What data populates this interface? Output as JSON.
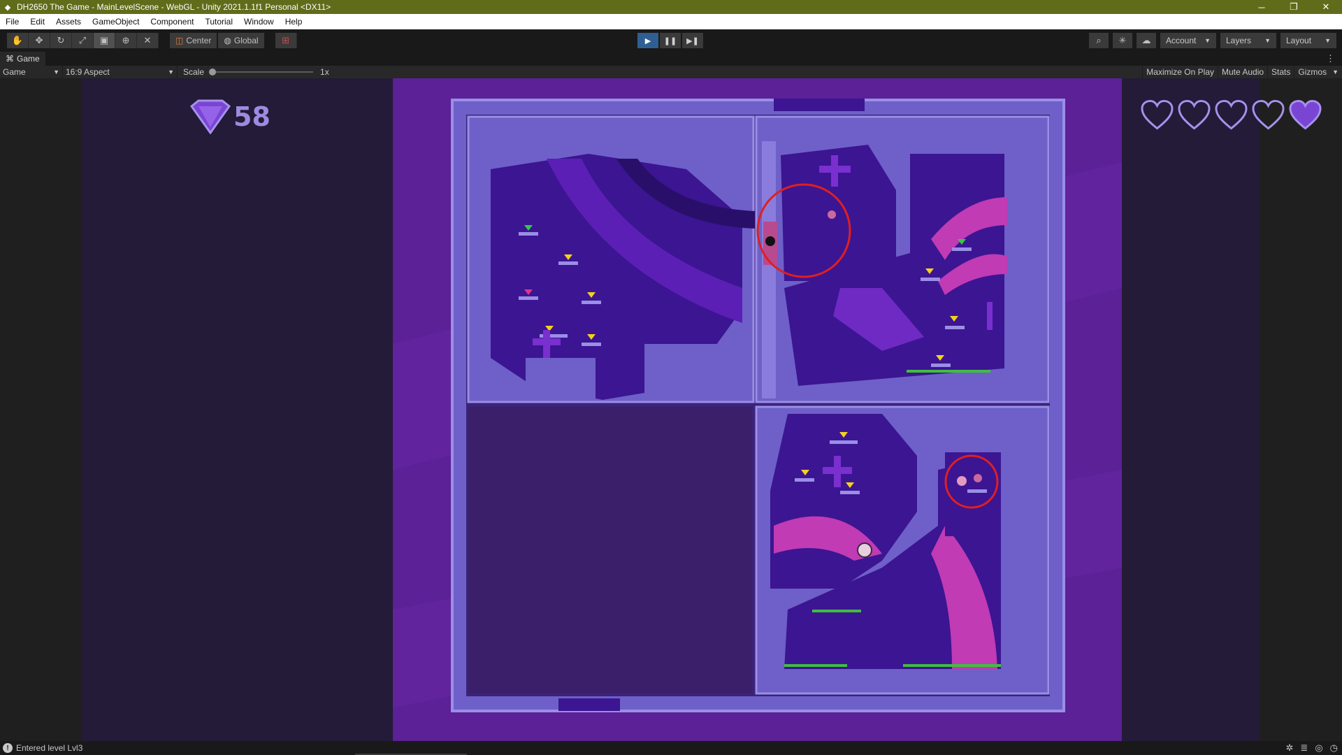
{
  "window": {
    "title": "DH2650 The Game - MainLevelScene - WebGL - Unity 2021.1.1f1 Personal <DX11>",
    "controls": [
      "─",
      "❐",
      "✕"
    ]
  },
  "menu": [
    "File",
    "Edit",
    "Assets",
    "GameObject",
    "Component",
    "Tutorial",
    "Window",
    "Help"
  ],
  "toolbar": {
    "tools": [
      "hand-icon",
      "move-icon",
      "rotate-icon",
      "scale-icon",
      "rect-icon",
      "transform-icon",
      "custom-tool-icon"
    ],
    "pivot_label": "Center",
    "space_label": "Global",
    "account_label": "Account",
    "layers_label": "Layers",
    "layout_label": "Layout"
  },
  "game_tab": {
    "label": "Game",
    "display_dropdown": "Game",
    "aspect_dropdown": "16:9 Aspect",
    "scale_label": "Scale",
    "scale_value": "1x",
    "scale_fraction": 0.0,
    "buttons": [
      "Maximize On Play",
      "Mute Audio",
      "Stats",
      "Gizmos"
    ]
  },
  "hud": {
    "gem_count": "58",
    "hearts_total": 5,
    "hearts_filled": 1
  },
  "colors": {
    "title_bar": "#606c1a",
    "game_background": "#5c2097",
    "wall": "#6e60c8",
    "wall_trim": "#9a8ee6",
    "cave": "#3c1592",
    "accent_pink": "#c03bb4",
    "highlight_ring": "#e01f1f"
  },
  "status": {
    "message": "Entered level Lvl3"
  }
}
